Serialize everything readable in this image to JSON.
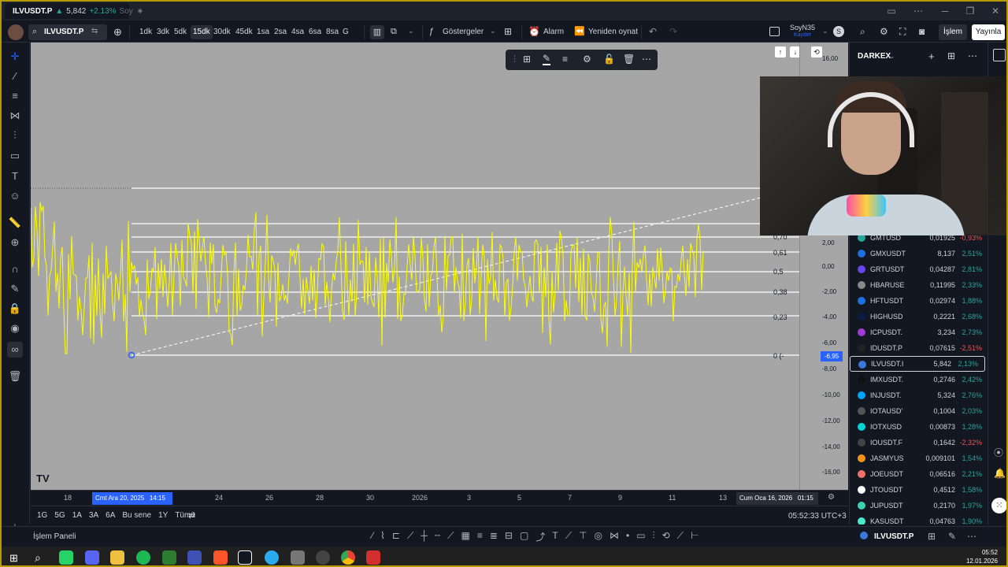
{
  "window": {
    "tab_title": "ILVUSDT.P",
    "tab_price": "5,842",
    "tab_change": "+2.13%",
    "tab_suffix": "Soy"
  },
  "toolbar": {
    "symbol": "ILVUSDT.P",
    "intervals": [
      "1dk",
      "3dk",
      "5dk",
      "15dk",
      "30dk",
      "45dk",
      "1sa",
      "2sa",
      "4sa",
      "6sa",
      "8sa",
      "G"
    ],
    "active_interval": "15dk",
    "indicators_label": "Göstergeler",
    "alarm_label": "Alarm",
    "replay_label": "Yeniden oynat",
    "layout_name": "SoyN35",
    "layout_saved": "Kaydet",
    "trade_label": "İşlem",
    "publish_label": "Yayınla"
  },
  "chart": {
    "fib_levels": [
      "0,70",
      "0,61",
      "0,5",
      "0,38",
      "0,23",
      "0 (-"
    ],
    "price_ticks": [
      "16,00",
      "2,00",
      "0,00",
      "-2,00",
      "-4,00",
      "-6,00",
      "-8,00",
      "-10,00",
      "-12,00",
      "-14,00",
      "-16,00"
    ],
    "price_tag": "-6,95",
    "time_labels": [
      "18",
      "24",
      "26",
      "28",
      "30",
      "2026",
      "3",
      "5",
      "7",
      "9",
      "11",
      "13"
    ],
    "time_cursor_left": "Cmt Ara 20, 2025   14:15",
    "time_cursor_right": "Cum Oca 16, 2026   01:15"
  },
  "bottombar": {
    "ranges": [
      "1G",
      "5G",
      "1A",
      "3A",
      "6A",
      "Bu sene",
      "1Y",
      "Tümü"
    ],
    "clock": "05:52:33 UTC+3"
  },
  "statusbar": {
    "panel_label": "İşlem Paneli",
    "symbol": "ILVUSDT.P"
  },
  "watchlist": {
    "title": "DARKEX",
    "rows": [
      {
        "symbol": "GMTUSD",
        "price": "0,01925",
        "change": "-0,93%",
        "dir": "dn",
        "color": "#26a69a"
      },
      {
        "symbol": "GMXUSDT",
        "price": "8,137",
        "change": "2,51%",
        "dir": "up",
        "color": "#1e6fe0"
      },
      {
        "symbol": "GRTUSDT",
        "price": "0,04287",
        "change": "2,81%",
        "dir": "up",
        "color": "#6747ed"
      },
      {
        "symbol": "HBARUSE",
        "price": "0,11995",
        "change": "2,33%",
        "dir": "up",
        "color": "#888888"
      },
      {
        "symbol": "HFTUSDT",
        "price": "0,02974",
        "change": "1,88%",
        "dir": "up",
        "color": "#1e6fe0"
      },
      {
        "symbol": "HIGHUSD",
        "price": "0,2221",
        "change": "2,68%",
        "dir": "up",
        "color": "#0b1c46"
      },
      {
        "symbol": "ICPUSDT.",
        "price": "3,234",
        "change": "2,73%",
        "dir": "up",
        "color": "#a23bd4"
      },
      {
        "symbol": "IDUSDT.P",
        "price": "0,07615",
        "change": "-2,51%",
        "dir": "dn",
        "color": "#222222"
      },
      {
        "symbol": "ILVUSDT.I",
        "price": "5,842",
        "change": "2,13%",
        "dir": "up",
        "color": "#3c78d8"
      },
      {
        "symbol": "IMXUSDT.",
        "price": "0,2746",
        "change": "2,42%",
        "dir": "up",
        "color": "#111111"
      },
      {
        "symbol": "INJUSDT.",
        "price": "5,324",
        "change": "2,76%",
        "dir": "up",
        "color": "#00a3ff"
      },
      {
        "symbol": "IOTAUSD'",
        "price": "0,1004",
        "change": "2,03%",
        "dir": "up",
        "color": "#555555"
      },
      {
        "symbol": "IOTXUSD",
        "price": "0,00873",
        "change": "1,28%",
        "dir": "up",
        "color": "#00d4d5"
      },
      {
        "symbol": "IOUSDT.F",
        "price": "0,1642",
        "change": "-2,32%",
        "dir": "dn",
        "color": "#444444"
      },
      {
        "symbol": "JASMYUS",
        "price": "0,009101",
        "change": "1,54%",
        "dir": "up",
        "color": "#f7931a"
      },
      {
        "symbol": "JOEUSDT",
        "price": "0,06516",
        "change": "2,21%",
        "dir": "up",
        "color": "#f2716a"
      },
      {
        "symbol": "JTOUSDT",
        "price": "0,4512",
        "change": "1,58%",
        "dir": "up",
        "color": "#ffffff"
      },
      {
        "symbol": "JUPUSDT",
        "price": "0,2170",
        "change": "1,97%",
        "dir": "up",
        "color": "#3ad2b2"
      },
      {
        "symbol": "KASUSDT",
        "price": "0,04763",
        "change": "1,90%",
        "dir": "up",
        "color": "#49eacb"
      }
    ]
  },
  "taskbar": {
    "clock_time": "05:52",
    "clock_date": "12.01.2026"
  }
}
